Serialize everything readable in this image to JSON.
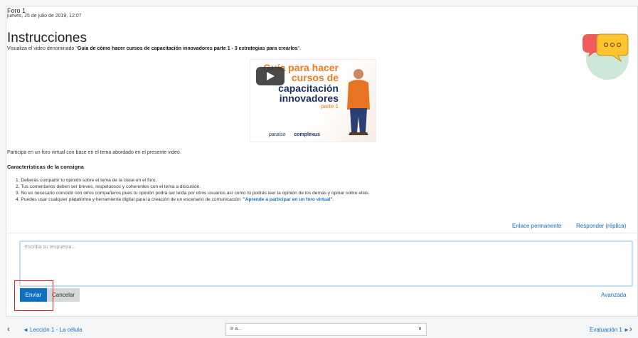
{
  "post": {
    "author": "Foro 1",
    "date": "jueves, 25 de julio de 2019, 12:07"
  },
  "content": {
    "heading": "Instrucciones",
    "intro_prefix": "Visualiza el video denominado \"",
    "intro_bold": "Guía de cómo hacer cursos de capacitación innovadores parte 1 - 3 estrategias para crearlos",
    "intro_suffix": "\".",
    "video": {
      "line1": "Guía para hacer",
      "line2": "cursos de",
      "line3": "capacitación",
      "line4": "innovadores",
      "line5": "parte 1",
      "logo1": "paraíso",
      "logo2": "complexus"
    },
    "participa": "Participa en un foro virtual con base en el tema abordado en el presente video.",
    "features_title": "Características de la consigna",
    "rules": [
      "1. Deberás compartir tu opinión sobre el tema de la clase en el foro.",
      "2. Tus comentarios deben ser breves, respetuosos y coherentes con el tema a discusión.",
      "3. No es necesario coincidir con otros compañeros pues tu opinión podrá ser leída por otros usuarios así como tú podrás leer la opinión de los demás y opinar sobre ellas."
    ],
    "rule4_prefix": "4. Puedes usar cualquier plataforma y herramienta digital para la creación de un escenario de comunicación: ",
    "rule4_link": "\"Aprende a participar en un foro virtual\"",
    "rule4_suffix": "."
  },
  "actions": {
    "permalink": "Enlace permanente",
    "reply": "Responder (réplica)"
  },
  "reply_form": {
    "placeholder": "Escriba su respuesta...",
    "send": "Enviar",
    "cancel": "Cancelar",
    "advanced": "Avanzada"
  },
  "navigation": {
    "prev_arrow": "‹",
    "prev": "◄ Lección 1 - La célula",
    "jump_placeholder": "Ir a...",
    "jump_caret": "⬍",
    "next": "Evaluación 1 ►",
    "next_arrow": "›"
  },
  "colors": {
    "link": "#0f6fc6",
    "send_button": "#0f6fc6",
    "cancel_button": "#d4d8db",
    "highlight": "#e01f1f",
    "chat_circle": "#cde8d8",
    "chat_bubble_yellow": "#ffc531",
    "chat_bubble_red": "#ef5b5b"
  },
  "icons": {
    "play": "play-icon",
    "chat": "chat-bubbles-icon",
    "prev": "chevron-left-icon",
    "next": "chevron-right-icon",
    "select": "select-caret-icon"
  }
}
